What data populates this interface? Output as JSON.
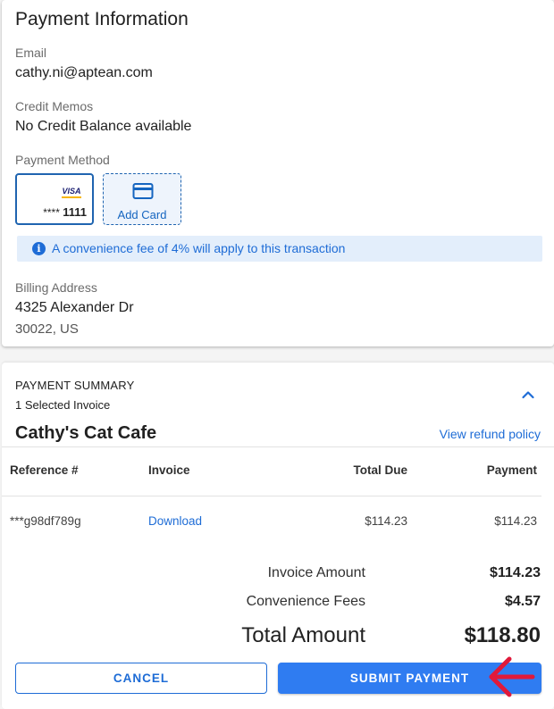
{
  "payment_info": {
    "title": "Payment Information",
    "email_label": "Email",
    "email_value": "cathy.ni@aptean.com",
    "credit_memos_label": "Credit Memos",
    "credit_memos_value": "No Credit Balance available",
    "payment_method_label": "Payment Method",
    "saved_card": {
      "brand": "VISA",
      "masked_prefix": "****",
      "last4": "1111"
    },
    "add_card_label": "Add Card",
    "fee_notice": "A convenience fee of 4% will apply to this transaction",
    "billing_label": "Billing Address",
    "billing_line1": "4325 Alexander Dr",
    "billing_line2": "30022, US"
  },
  "summary": {
    "title": "PAYMENT SUMMARY",
    "subtitle": "1 Selected Invoice",
    "merchant": "Cathy's Cat Cafe",
    "refund_link": "View refund policy",
    "columns": [
      "Reference #",
      "Invoice",
      "Total Due",
      "Payment"
    ],
    "rows": [
      {
        "reference": "***g98df789g",
        "invoice": "Download",
        "total_due": "$114.23",
        "payment": "$114.23"
      }
    ],
    "invoice_amount_label": "Invoice Amount",
    "invoice_amount_value": "$114.23",
    "convenience_fees_label": "Convenience Fees",
    "convenience_fees_value": "$4.57",
    "total_label": "Total Amount",
    "total_value": "$118.80",
    "cancel_label": "CANCEL",
    "submit_label": "SUBMIT PAYMENT"
  },
  "colors": {
    "accent": "#2f7cf1",
    "link": "#1e6cd6",
    "notice_bg": "#e3eefb",
    "annotation_arrow": "#e0193a"
  },
  "icons": {
    "info": "info-icon",
    "add_card": "credit-card-icon",
    "collapse": "chevron-up-icon",
    "annotation": "red-arrow-icon"
  }
}
